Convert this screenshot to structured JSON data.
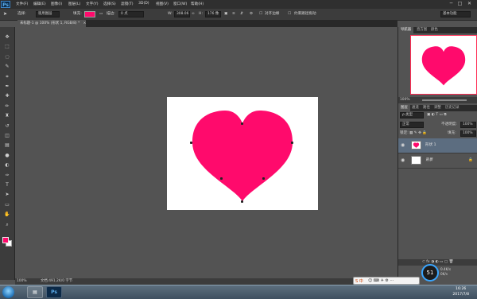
{
  "app": {
    "logo": "Ps"
  },
  "menu": [
    "文件(F)",
    "编辑(E)",
    "图像(I)",
    "图层(L)",
    "文字(Y)",
    "选择(S)",
    "滤镜(T)",
    "3D(D)",
    "视图(V)",
    "窗口(W)",
    "帮助(H)"
  ],
  "window_controls": {
    "minimize": "─",
    "maximize": "□",
    "close": "✕"
  },
  "options": {
    "select_label": "选择:",
    "select_value": "现用图层",
    "fill_label": "填充:",
    "stroke_label": "描边:",
    "stroke_width": "0 点",
    "w_label": "W:",
    "w_value": "308.06",
    "h_label": "H:",
    "h_value": "176 像",
    "align_edges": "对齐边缘",
    "constrain_path": "约束路径拖动",
    "workspace": "基本功能"
  },
  "doc_tab": {
    "title": "未标题-1 @ 100% (形状 1, RGB/8) *",
    "close": "×"
  },
  "tools": [
    "move",
    "marquee",
    "lasso",
    "quick-select",
    "crop",
    "eyedropper",
    "healing",
    "brush",
    "stamp",
    "history-brush",
    "eraser",
    "gradient",
    "blur",
    "dodge",
    "pen",
    "type",
    "path-select",
    "shape",
    "hand",
    "zoom"
  ],
  "tool_glyphs": [
    "✥",
    "⬚",
    "◌",
    "✎",
    "⌗",
    "✒",
    "✚",
    "✏",
    "♜",
    "↺",
    "◫",
    "▤",
    "●",
    "◐",
    "✑",
    "T",
    "➤",
    "▭",
    "✋",
    "⌕"
  ],
  "colors": {
    "foreground": "#ff0a6c",
    "background": "#ffffff",
    "heart": "#ff0a6c"
  },
  "status": {
    "zoom": "100%",
    "doc_info": "文档:491.2K/0 字节"
  },
  "navigator": {
    "tabs": [
      "导航器",
      "直方图",
      "颜色"
    ],
    "zoom": "100%"
  },
  "layers_panel": {
    "tabs": [
      "图层",
      "通道",
      "路径",
      "调整",
      "历史记录"
    ],
    "filter_label": "ρ 类型",
    "blend_mode": "正常",
    "opacity_label": "不透明度:",
    "opacity_value": "100%",
    "lock_label": "锁定:",
    "fill_label": "填充:",
    "fill_value": "100%",
    "layers": [
      {
        "name": "形状 1",
        "selected": true
      },
      {
        "name": "背景",
        "selected": false
      }
    ]
  },
  "system": {
    "cpu_gauge": "51",
    "net_up": "0.4K/s",
    "net_down": "0K/s",
    "time": "16:26",
    "date": "2017/7/8",
    "ime": "S 中"
  }
}
